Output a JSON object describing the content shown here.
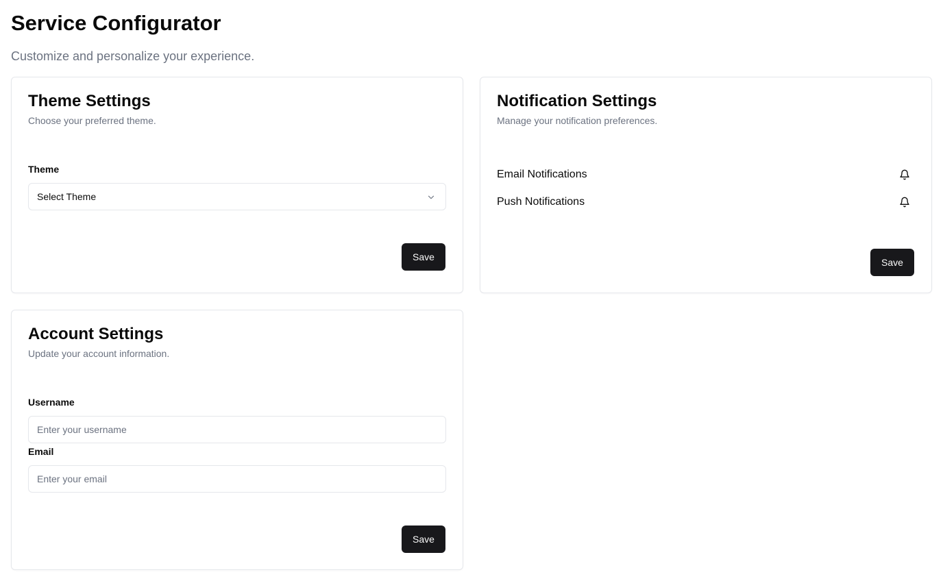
{
  "page": {
    "title": "Service Configurator",
    "subtitle": "Customize and personalize your experience."
  },
  "theme_card": {
    "title": "Theme Settings",
    "description": "Choose your preferred theme.",
    "field_label": "Theme",
    "select_value": "Select Theme",
    "select_icon": "chevron-down-icon",
    "save_label": "Save"
  },
  "notification_card": {
    "title": "Notification Settings",
    "description": "Manage your notification preferences.",
    "items": [
      {
        "label": "Email Notifications",
        "icon": "bell-icon"
      },
      {
        "label": "Push Notifications",
        "icon": "bell-icon"
      }
    ],
    "save_label": "Save"
  },
  "account_card": {
    "title": "Account Settings",
    "description": "Update your account information.",
    "username_label": "Username",
    "username_placeholder": "Enter your username",
    "username_value": "",
    "email_label": "Email",
    "email_placeholder": "Enter your email",
    "email_value": "",
    "save_label": "Save"
  },
  "colors": {
    "primary_button": "#18181b",
    "border": "#e5e7eb",
    "muted_text": "#6b7280"
  }
}
